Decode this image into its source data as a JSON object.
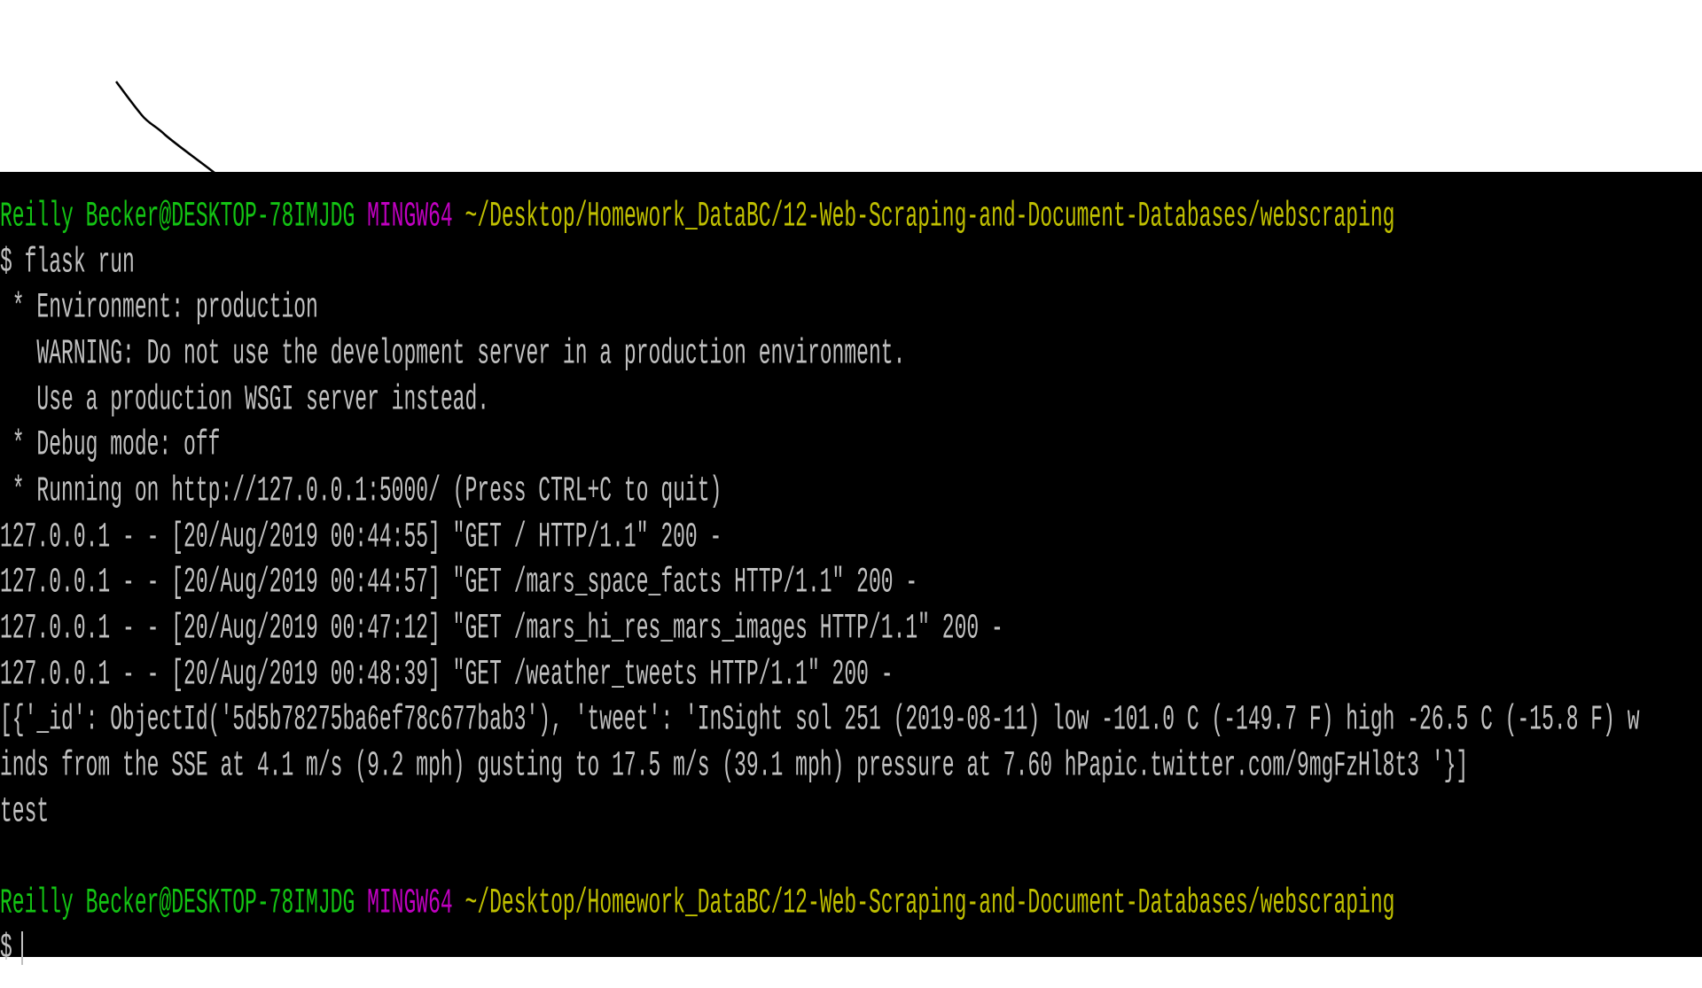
{
  "terminal": {
    "prompt": {
      "user_host": "Reilly Becker@DESKTOP-78IMJDG",
      "system": "MINGW64",
      "path": "~/Desktop/Homework_DataBC/12-Web-Scraping-and-Document-Databases/webscraping"
    },
    "lines": [
      "$ flask run",
      " * Environment: production",
      "   WARNING: Do not use the development server in a production environment.",
      "   Use a production WSGI server instead.",
      " * Debug mode: off",
      " * Running on http://127.0.0.1:5000/ (Press CTRL+C to quit)",
      "127.0.0.1 - - [20/Aug/2019 00:44:55] \"GET / HTTP/1.1\" 200 -",
      "127.0.0.1 - - [20/Aug/2019 00:44:57] \"GET /mars_space_facts HTTP/1.1\" 200 -",
      "127.0.0.1 - - [20/Aug/2019 00:47:12] \"GET /mars_hi_res_mars_images HTTP/1.1\" 200 -",
      "127.0.0.1 - - [20/Aug/2019 00:48:39] \"GET /weather_tweets HTTP/1.1\" 200 -",
      "[{'_id': ObjectId('5d5b78275ba6ef78c677bab3'), 'tweet': 'InSight sol 251 (2019-08-11) low -101.0 C (-149.7 F) high -26.5 C (-15.8 F) w",
      "inds from the SSE at 4.1 m/s (9.2 mph) gusting to 17.5 m/s (39.1 mph) pressure at 7.60 hPapic.twitter.com/9mgFzHl8t3 '}]",
      "test"
    ],
    "final_prompt_symbol": "$"
  },
  "colors": {
    "user_host": "#13c313",
    "system": "#c000c0",
    "path": "#c0c000",
    "text": "#c0c0c0"
  }
}
